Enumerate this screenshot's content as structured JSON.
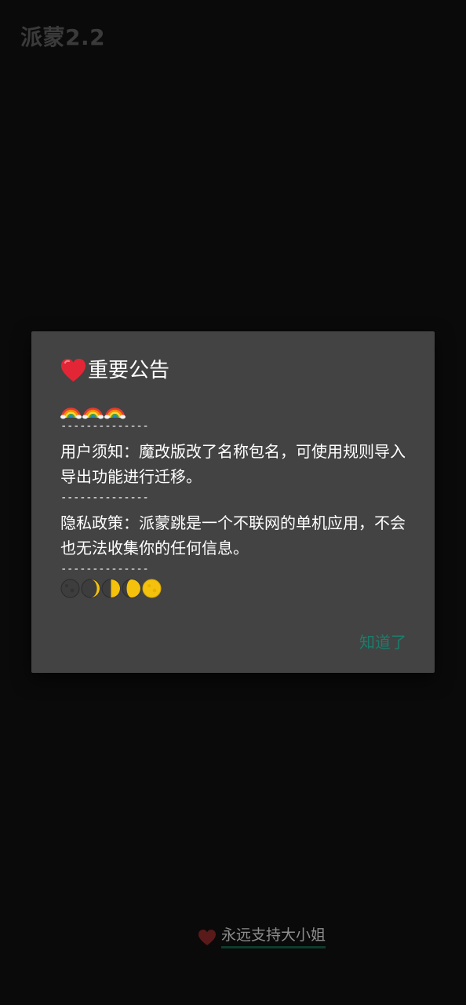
{
  "app": {
    "title": "派蒙2.2"
  },
  "dialog": {
    "title": "重要公告",
    "title_icon": "heart-icon",
    "rainbow_icons": [
      "rainbow-icon",
      "rainbow-icon",
      "rainbow-icon"
    ],
    "divider": "--------------",
    "user_notice": "用户须知：魔改版改了名称包名，可使用规则导入导出功能进行迁移。",
    "privacy_policy": "隐私政策：派蒙跳是一个不联网的单机应用，不会也无法收集你的任何信息。",
    "moon_icons": [
      "new-moon-icon",
      "waning-crescent-moon-icon",
      "first-quarter-moon-icon",
      "waxing-gibbous-moon-icon",
      "full-moon-icon"
    ],
    "confirm_label": "知道了"
  },
  "footer": {
    "text": "永远支持大小姐",
    "icon": "heart-icon"
  },
  "colors": {
    "background": "#0a0a0a",
    "dialog_bg": "#434343",
    "accent": "#1c7c6c",
    "heart": "#e32636",
    "footer_heart": "#5a1a1a"
  }
}
